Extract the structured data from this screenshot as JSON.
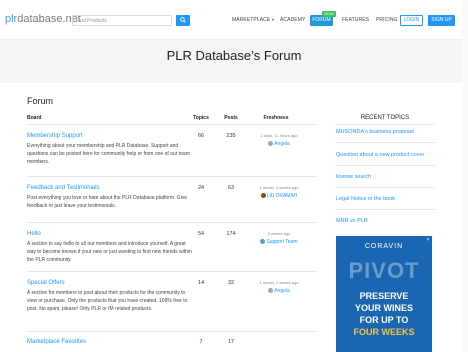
{
  "header": {
    "logo_brand": "plr",
    "logo_rest": "database.net",
    "search_placeholder": "Find Products",
    "nav": {
      "marketplace": "MARKETPLACE",
      "academy": "ACADEMY",
      "forum": "FORUM",
      "new_badge": "NEW",
      "features": "FEATURES",
      "pricing": "PRICING",
      "login": "LOGIN",
      "signup": "SIGN UP"
    }
  },
  "hero": {
    "title": "PLR Database’s Forum"
  },
  "forum": {
    "section_title": "Forum",
    "columns": {
      "board": "Board",
      "topics": "Topics",
      "posts": "Posts",
      "freshness": "Freshness"
    },
    "rows": [
      {
        "title": "Membership Support",
        "description": "Everything about your membership and PLR Database. Support and questions can be posted here for community help or from one of our team members.",
        "topics": "66",
        "posts": "235",
        "freshness": "2 days, 11 hours ago",
        "user": "Angela",
        "avatar_color": "#9aa6b2"
      },
      {
        "title": "Feedback and Testimonials",
        "description": "Post everything you love or hate about the PLR Database platform. Give feedback or just leave your testimonials.",
        "topics": "24",
        "posts": "63",
        "freshness": "1 month, 4 weeks ago",
        "user": "LIU DRAMAH",
        "avatar_color": "#8b4513"
      },
      {
        "title": "Hello",
        "description": "A section to say hello to all our members and introduce yourself. A great way to become known if your new or just wanting to find new friends within the PLR community.",
        "topics": "54",
        "posts": "174",
        "freshness": "3 weeks ago",
        "user": "Support Team",
        "avatar_color": "#5b9bd5"
      },
      {
        "title": "Special Offers",
        "description": "A section for members to post about their products for the community to view or purchase. Only the products that you have created. 100% free to post. No spam, please! Only PLR or IM related products.",
        "topics": "14",
        "posts": "32",
        "freshness": "1 month, 2 weeks ago",
        "user": "Angela",
        "avatar_color": "#9aa6b2"
      },
      {
        "title": "Marketplace Favorites",
        "description": "",
        "topics": "7",
        "posts": "17",
        "freshness": "",
        "user": "",
        "avatar_color": "#9aa6b2"
      }
    ]
  },
  "sidebar": {
    "title": "RECENT TOPICS",
    "items": [
      "MUSONDA's business proposal",
      "Question about a new product cover",
      "license search",
      "Legal Notice in the book",
      "MRR vs PLR"
    ]
  },
  "ad": {
    "brand": "CORAVIN",
    "watermark": "PIVOT",
    "line1": "PRESERVE",
    "line2": "YOUR WINES",
    "line3": "FOR UP TO",
    "line4": "FOUR WEEKS",
    "close": "×"
  }
}
